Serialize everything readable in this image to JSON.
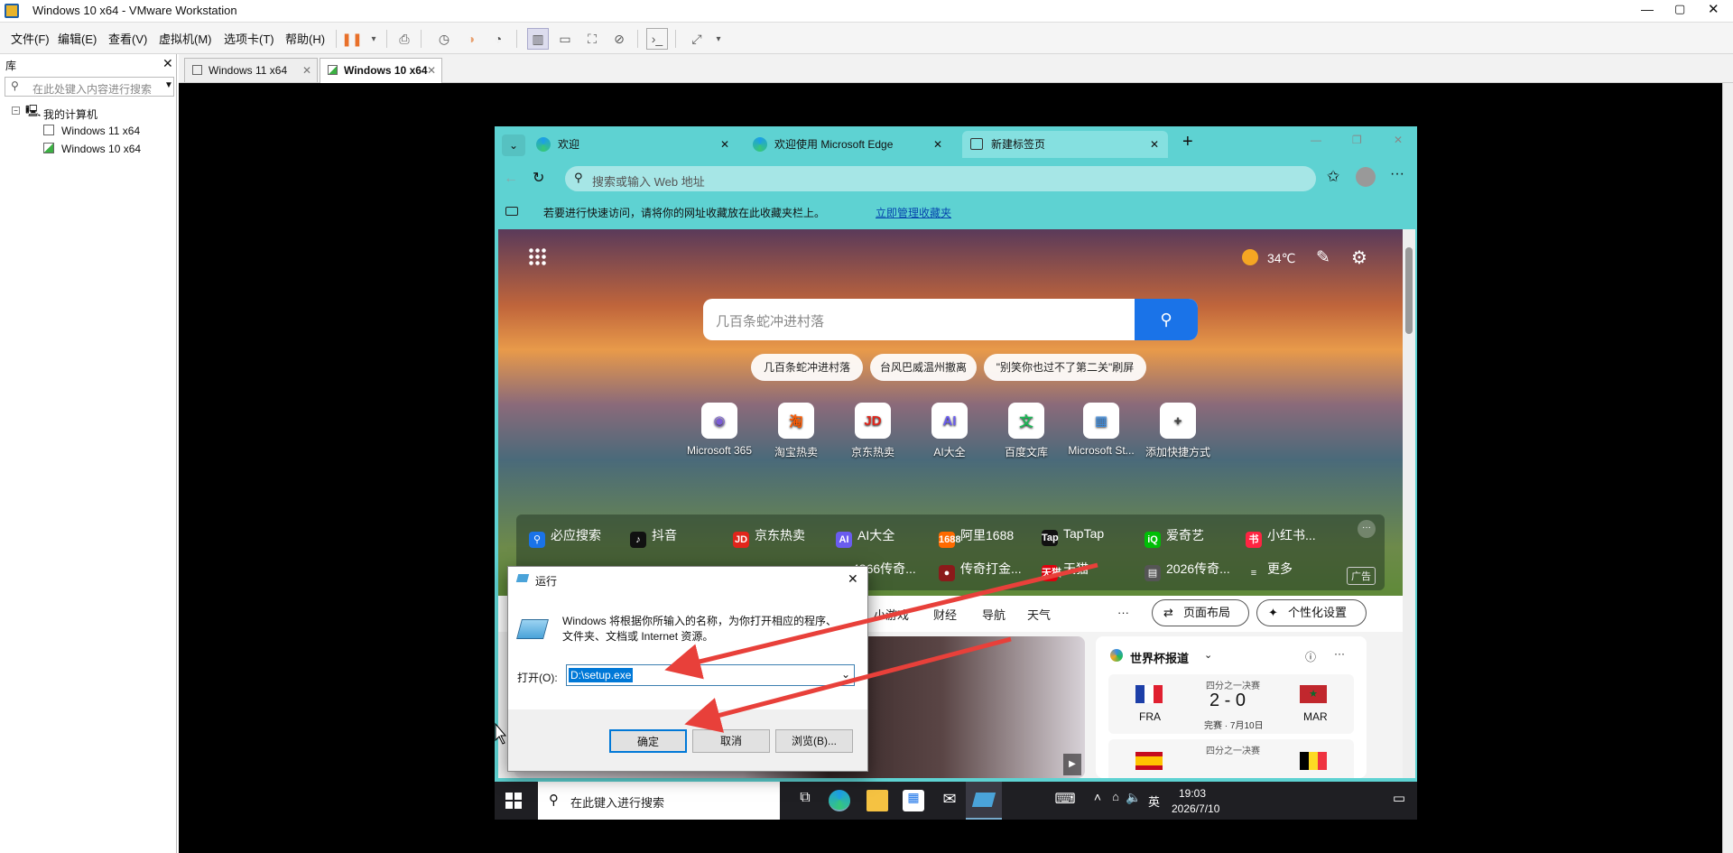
{
  "window": {
    "title": "Windows 10 x64 - VMware Workstation"
  },
  "menu": [
    "文件(F)",
    "编辑(E)",
    "查看(V)",
    "虚拟机(M)",
    "选项卡(T)",
    "帮助(H)"
  ],
  "library": {
    "title": "库",
    "search_placeholder": "在此处键入内容进行搜索",
    "root": "我的计算机",
    "vms": [
      "Windows 11 x64",
      "Windows 10 x64"
    ]
  },
  "vm_tabs": [
    "Windows 11 x64",
    "Windows 10 x64"
  ],
  "edge": {
    "tabs": [
      "欢迎",
      "欢迎使用 Microsoft Edge",
      "新建标签页"
    ],
    "address_placeholder": "搜索或输入 Web 地址",
    "favbar_text": "若要进行快速访问，请将你的网址收藏放在此收藏夹栏上。",
    "favbar_link": "立即管理收藏夹",
    "weather": "34℃",
    "search_placeholder": "几百条蛇冲进村落",
    "suggestions": [
      "几百条蛇冲进村落",
      "台风巴威温州撤离",
      "\"别笑你也过不了第二关\"刷屏"
    ],
    "quicklinks": [
      {
        "label": "Microsoft 365",
        "glyph": "◉",
        "color": "#7b5cd6"
      },
      {
        "label": "淘宝热卖",
        "glyph": "淘",
        "color": "#ff5a00"
      },
      {
        "label": "京东热卖",
        "glyph": "JD",
        "color": "#e1251b"
      },
      {
        "label": "AI大全",
        "glyph": "AI",
        "color": "#6a5cf0"
      },
      {
        "label": "百度文库",
        "glyph": "文",
        "color": "#19b955"
      },
      {
        "label": "Microsoft St...",
        "glyph": "▦",
        "color": "#3a8ee6"
      },
      {
        "label": "添加快捷方式",
        "glyph": "+",
        "color": "#444"
      }
    ],
    "hot_row1": [
      {
        "label": "必应搜索",
        "glyph": "⚲",
        "color": "#1a73e8"
      },
      {
        "label": "抖音",
        "glyph": "♪",
        "color": "#111"
      },
      {
        "label": "京东热卖",
        "glyph": "JD",
        "color": "#e1251b"
      },
      {
        "label": "AI大全",
        "glyph": "AI",
        "color": "#6a5cf0"
      },
      {
        "label": "阿里1688",
        "glyph": "1688",
        "color": "#ff6a00"
      },
      {
        "label": "TapTap",
        "glyph": "Tap",
        "color": "#111"
      },
      {
        "label": "爱奇艺",
        "glyph": "iQ",
        "color": "#00be06"
      },
      {
        "label": "小红书...",
        "glyph": "书",
        "color": "#ff2442"
      }
    ],
    "hot_row2": [
      {
        "label": "4366传奇...",
        "glyph": "",
        "color": "#333"
      },
      {
        "label": "传奇打金...",
        "glyph": "●",
        "color": "#8b1a1a"
      },
      {
        "label": "天猫",
        "glyph": "天猫",
        "color": "#e0000c"
      },
      {
        "label": "2026传奇...",
        "glyph": "▤",
        "color": "#555"
      },
      {
        "label": "更多",
        "glyph": "≡",
        "color": "transparent"
      }
    ],
    "ad_label": "广告",
    "categories": [
      "小游戏",
      "财经",
      "导航",
      "天气",
      "···"
    ],
    "layout_btn": "页面布局",
    "personalize_btn": "个性化设置",
    "news_card": {
      "title": "世界杯报道",
      "match1": {
        "stage": "四分之一决赛",
        "home": "FRA",
        "away": "MAR",
        "score": "2 - 0",
        "status": "完赛 · 7月10日"
      },
      "match2": {
        "stage": "四分之一决赛"
      }
    }
  },
  "run_dialog": {
    "title": "运行",
    "description": "Windows 将根据你所输入的名称，为你打开相应的程序、文件夹、文档或 Internet 资源。",
    "open_label": "打开(O):",
    "value": "D:\\setup.exe",
    "ok": "确定",
    "cancel": "取消",
    "browse": "浏览(B)..."
  },
  "taskbar": {
    "search_placeholder": "在此键入进行搜索",
    "ime": "英",
    "time": "19:03",
    "date": "2026/7/10"
  }
}
